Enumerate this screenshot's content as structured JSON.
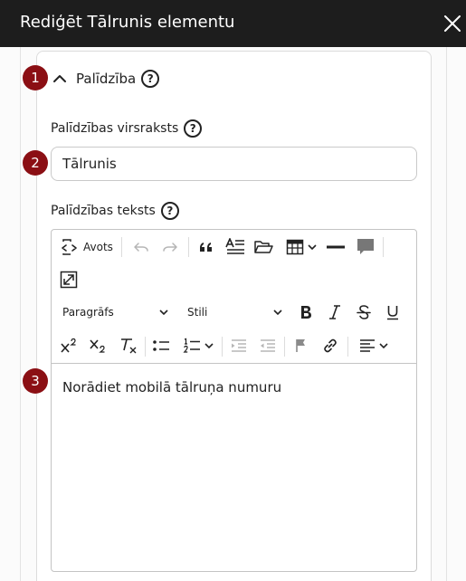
{
  "dialog": {
    "title": "Rediģēt Tālrunis elementu"
  },
  "section": {
    "title": "Palīdzība"
  },
  "help_heading": {
    "label": "Palīdzības virsraksts",
    "value": "Tālrunis"
  },
  "help_text": {
    "label": "Palīdzības teksts",
    "content": "Norādiet mobilā tālruņa numuru"
  },
  "editor_toolbar": {
    "source_label": "Avots",
    "paragraph_format": "Paragrāfs",
    "styles": "Stili"
  },
  "badges": [
    "1",
    "2",
    "3"
  ],
  "help_mark": "?",
  "colors": {
    "titlebar": "#1d1d1d",
    "badge": "#8b0f14",
    "border": "#c9c9c9"
  }
}
